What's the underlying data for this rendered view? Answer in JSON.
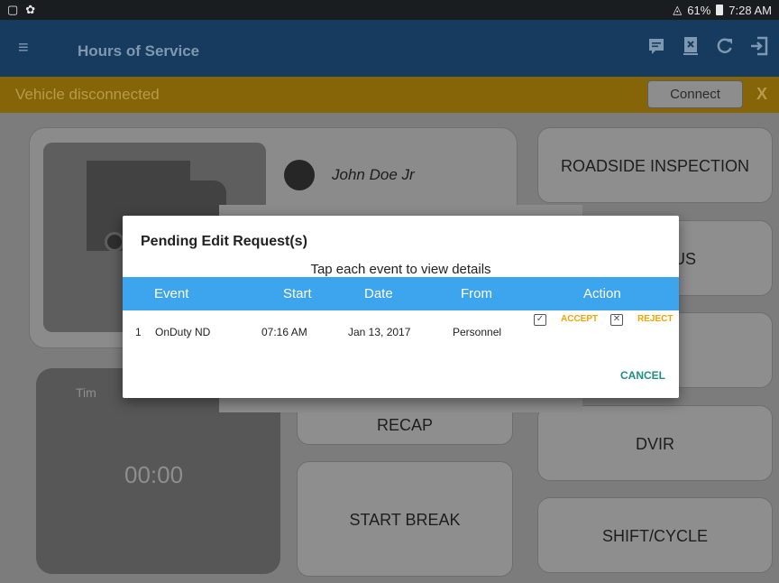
{
  "status_bar": {
    "battery": "61%",
    "time": "7:28 AM"
  },
  "app_bar": {
    "title": "Hours of Service",
    "icons": [
      "menu-icon",
      "message-icon",
      "document-x-icon",
      "refresh-icon",
      "logout-icon"
    ]
  },
  "warning_bar": {
    "message": "Vehicle disconnected",
    "connect_label": "Connect",
    "close_label": "X"
  },
  "dashboard": {
    "driver_name": "John Doe Jr",
    "timer_label": "Tim",
    "timer_value": "00:00",
    "buttons": {
      "roadside": "ROADSIDE INSPECTION",
      "status_partial": "US",
      "recap_partial": "RECAP",
      "dvir": "DVIR",
      "start_break": "START BREAK",
      "shift_cycle": "SHIFT/CYCLE"
    }
  },
  "dialog": {
    "title": "Pending Edit Request(s)",
    "subtitle": "Tap each event to view details",
    "columns": [
      "Event",
      "Start",
      "Date",
      "From",
      "Action"
    ],
    "rows": [
      {
        "index": "1",
        "event": "OnDuty ND",
        "start": "07:16 AM",
        "date": "Jan 13, 2017",
        "from": "Personnel",
        "accept": "ACCEPT",
        "reject": "REJECT"
      }
    ],
    "cancel_label": "CANCEL"
  },
  "colors": {
    "app_bar": "#173b5e",
    "warning_bar": "#866509",
    "table_header": "#3da4ee",
    "accept_reject": "#f5a300",
    "cancel": "#1e8e86"
  }
}
